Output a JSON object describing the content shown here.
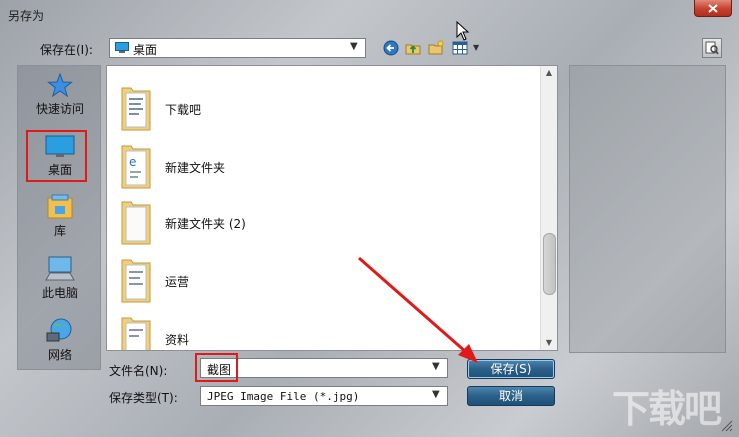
{
  "window": {
    "title": "另存为"
  },
  "savein": {
    "label": "保存在(I):",
    "value": "桌面"
  },
  "nav": [
    {
      "label": "快速访问",
      "icon": "star-icon"
    },
    {
      "label": "桌面",
      "icon": "desktop-icon"
    },
    {
      "label": "库",
      "icon": "library-icon"
    },
    {
      "label": "此电脑",
      "icon": "computer-icon"
    },
    {
      "label": "网络",
      "icon": "network-icon"
    }
  ],
  "files": [
    {
      "name": "下载吧"
    },
    {
      "name": "新建文件夹"
    },
    {
      "name": "新建文件夹 (2)"
    },
    {
      "name": "运营"
    },
    {
      "name": "资料"
    }
  ],
  "filename": {
    "label": "文件名(N):",
    "value": "截图"
  },
  "filetype": {
    "label": "保存类型(T):",
    "value": "JPEG Image File (*.jpg)"
  },
  "buttons": {
    "save": "保存(S)",
    "cancel": "取消"
  },
  "watermark": "下载吧",
  "colors": {
    "accent_button": "#2b6088",
    "highlight_frame": "#e01919"
  }
}
